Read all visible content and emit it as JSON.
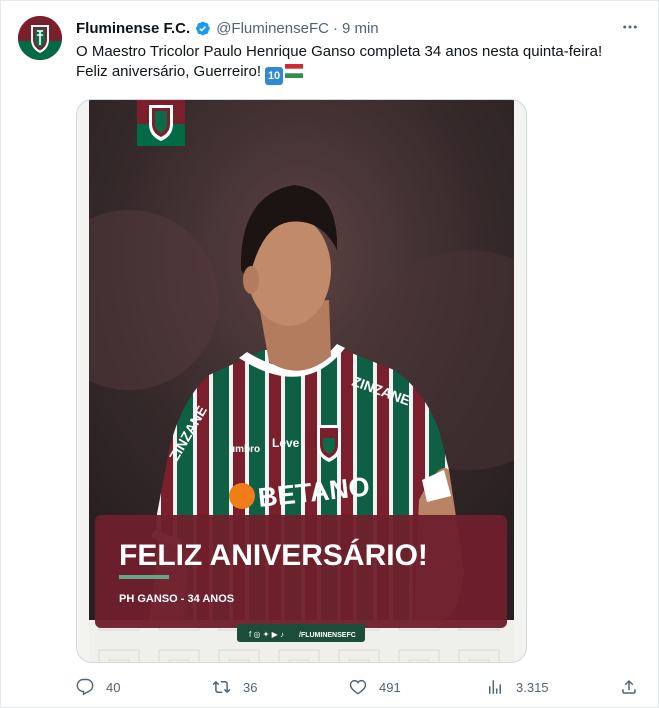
{
  "tweet": {
    "display_name": "Fluminense F.C.",
    "handle": "@FluminenseFC",
    "separator": "·",
    "time": "9 min",
    "text": "O Maestro Tricolor Paulo Henrique Ganso completa 34 anos nesta quinta-feira! Feliz aniversário, Guerreiro!",
    "emoji_number": "10"
  },
  "media": {
    "sponsor_chest": "BETANO",
    "sponsor_shoulder": "ZINZANE",
    "sponsor_leve": "Leve",
    "brand_umbro": "umbro",
    "headline": "FELIZ ANIVERSÁRIO!",
    "subline": "PH GANSO - 34 ANOS",
    "social_handle": "/FLUMINENSEFC"
  },
  "colors": {
    "club_maroon": "#7a1f2b",
    "club_green": "#006b45",
    "verified_blue": "#1d9bf0",
    "action_gray": "#536471"
  },
  "actions": {
    "replies": "40",
    "retweets": "36",
    "likes": "491",
    "views": "3.315"
  },
  "icons": [
    "club-crest-icon",
    "verified-badge-icon",
    "more-options-icon",
    "reply-icon",
    "retweet-icon",
    "like-icon",
    "views-icon",
    "share-icon"
  ]
}
